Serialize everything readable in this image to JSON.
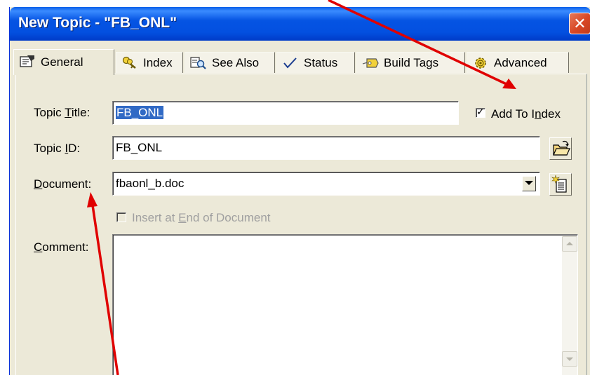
{
  "window": {
    "title": "New Topic - \"FB_ONL\""
  },
  "tabs": [
    {
      "label": "General",
      "icon": "properties-icon",
      "active": true
    },
    {
      "label": "Index",
      "icon": "keys-icon"
    },
    {
      "label": "See Also",
      "icon": "search-topics-icon"
    },
    {
      "label": "Status",
      "icon": "checkmark-icon"
    },
    {
      "label": "Build Tags",
      "icon": "tag-icon"
    },
    {
      "label": "Advanced",
      "icon": "gear-icon"
    }
  ],
  "form": {
    "topic_title_label": "Topic Title:",
    "topic_title_value": "FB_ONL",
    "add_to_index_label": "Add To Index",
    "add_to_index_checked": true,
    "topic_id_label": "Topic ID:",
    "topic_id_value": "FB_ONL",
    "document_label": "Document:",
    "document_value": "fbaonl_b.doc",
    "insert_at_end_label": "Insert at End of Document",
    "insert_at_end_checked": false,
    "comment_label": "Comment:",
    "comment_value": ""
  },
  "colors": {
    "titlebar": "#0554E3",
    "face": "#ECE9D8",
    "selection": "#316AC5",
    "arrow": "#E00000"
  }
}
